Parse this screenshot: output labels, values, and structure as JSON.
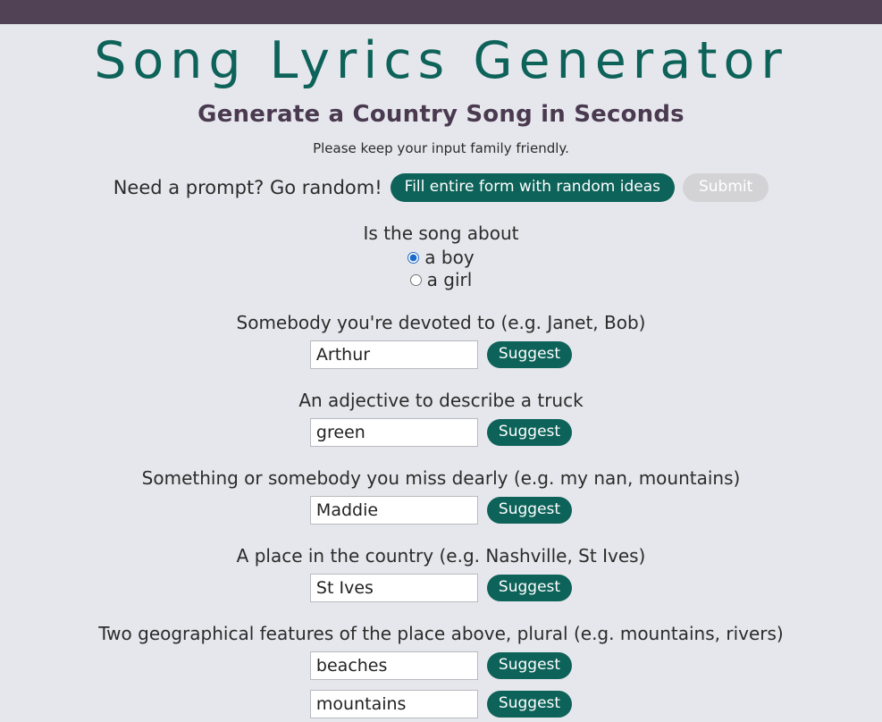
{
  "header": {
    "title": "Song Lyrics Generator",
    "subtitle": "Generate a Country Song in Seconds",
    "note": "Please keep your input family friendly."
  },
  "prompt": {
    "label": "Need a prompt? Go random!",
    "fill_button": "Fill entire form with random ideas",
    "submit_button": "Submit"
  },
  "colors": {
    "top_bar": "#524256",
    "background": "#e6e7ec",
    "accent_teal": "#0d6259",
    "subtitle_plum": "#4a3a50",
    "disabled_grey": "#d3d3d6",
    "radio_blue": "#1b6ac9"
  },
  "subject": {
    "label": "Is the song about",
    "options": [
      {
        "label": "a boy",
        "selected": true
      },
      {
        "label": "a girl",
        "selected": false
      }
    ]
  },
  "suggest_label": "Suggest",
  "fields": [
    {
      "label": "Somebody you're devoted to (e.g. Janet, Bob)",
      "inputs": [
        {
          "value": "Arthur"
        }
      ]
    },
    {
      "label": "An adjective to describe a truck",
      "inputs": [
        {
          "value": "green"
        }
      ]
    },
    {
      "label": "Something or somebody you miss dearly (e.g. my nan, mountains)",
      "inputs": [
        {
          "value": "Maddie"
        }
      ]
    },
    {
      "label": "A place in the country (e.g. Nashville, St Ives)",
      "inputs": [
        {
          "value": "St Ives"
        }
      ]
    },
    {
      "label": "Two geographical features of the place above, plural (e.g. mountains, rivers)",
      "inputs": [
        {
          "value": "beaches"
        },
        {
          "value": "mountains"
        }
      ]
    }
  ]
}
